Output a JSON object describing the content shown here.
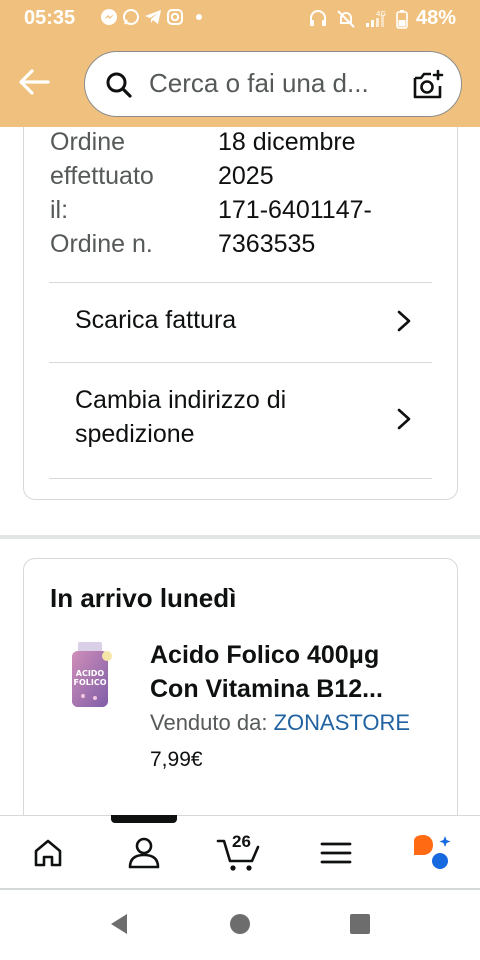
{
  "status_bar": {
    "time": "05:35",
    "battery": "48%",
    "network": "4G",
    "app_icons": [
      "messenger-icon",
      "whatsapp-icon",
      "telegram-icon",
      "instagram-icon"
    ],
    "status_icons": [
      "headphones-icon",
      "mute-icon",
      "signal-icon",
      "battery-icon"
    ]
  },
  "header": {
    "back_icon": "arrow-left-icon",
    "search_placeholder": "Cerca o fai una d...",
    "camera_icon": "camera-search-icon"
  },
  "order": {
    "label_lines": [
      "Ordine",
      "effettuato",
      "il:",
      "Ordine n."
    ],
    "value_lines": [
      "18 dicembre",
      "2025",
      "171-6401147-",
      "7363535"
    ],
    "actions": [
      {
        "label": "Scarica fattura"
      },
      {
        "label_lines": [
          "Cambia indirizzo di",
          "spedizione"
        ]
      }
    ]
  },
  "shipment": {
    "heading": "In arrivo lunedì",
    "product": {
      "title_lines": [
        "Acido Folico 400μg",
        "Con Vitamina B12..."
      ],
      "seller_prefix": "Venduto da:",
      "seller_name": "ZONASTORE",
      "price": "7,99€",
      "image_brand_text": "ACIDO FOLICO"
    }
  },
  "bottom_nav": {
    "items": [
      "home-icon",
      "account-icon",
      "cart-icon",
      "menu-icon",
      "rufus-icon"
    ],
    "cart_count": "26",
    "active": "account-icon"
  },
  "system_nav": [
    "back-triangle-icon",
    "home-circle-icon",
    "recents-square-icon"
  ],
  "colors": {
    "header_bg": "#f0c17e",
    "link": "#2162a1",
    "text": "#0f1111",
    "secondary_text": "#565959",
    "divider": "#d5d9d9",
    "rufus_orange": "#ff6a13",
    "rufus_blue": "#1769e0"
  }
}
